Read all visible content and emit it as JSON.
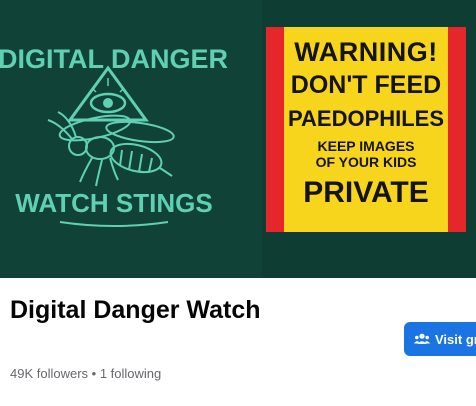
{
  "cover": {
    "logo": {
      "line1": "DIGITAL DANGER",
      "line2": "WATCH STINGS",
      "text_color": "#5fd1b2",
      "icons": [
        "eye-of-providence-icon",
        "wasp-icon"
      ]
    },
    "sign": {
      "line1": "WARNING!",
      "line2": "DON'T FEED",
      "line3": "PAEDOPHILES",
      "line4": "KEEP IMAGES",
      "line5": "OF YOUR KIDS",
      "line6": "PRIVATE",
      "background": "#f7d51d",
      "border": "#e5262a"
    }
  },
  "page": {
    "title": "Digital Danger Watch",
    "stats": "49K followers • 1 following"
  },
  "actions": {
    "visit_label": "Visit gro",
    "visit_icon": "group-icon",
    "accent": "#1b74e4"
  }
}
